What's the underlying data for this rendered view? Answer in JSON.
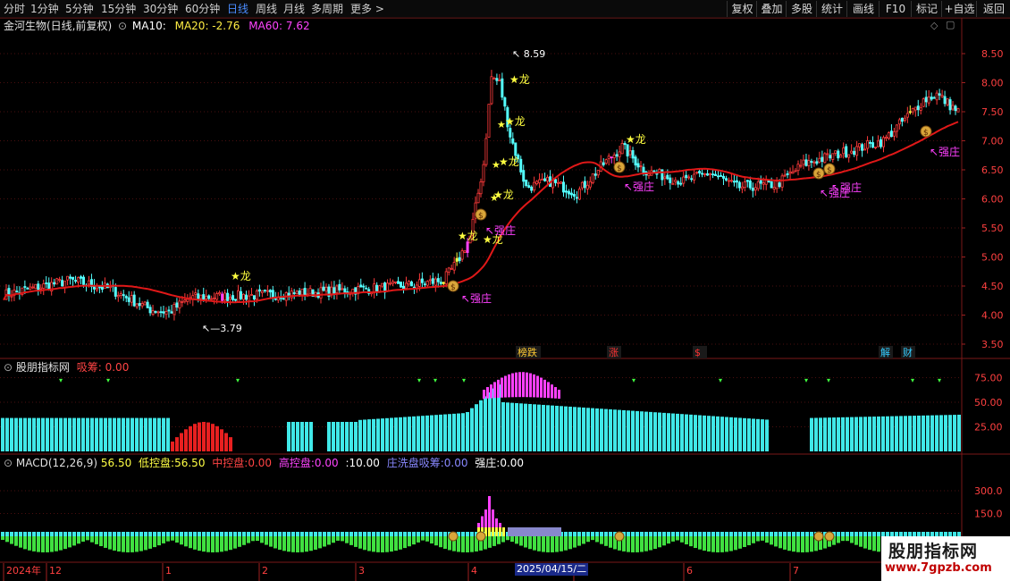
{
  "toolbar": {
    "periods": [
      "分时",
      "1分钟",
      "5分钟",
      "15分钟",
      "30分钟",
      "60分钟",
      "日线",
      "周线",
      "月线",
      "多周期",
      "更多"
    ],
    "active_period": "日线",
    "more_arrow": ">",
    "right_buttons": [
      "复权",
      "叠加",
      "多股",
      "统计",
      "画线",
      "F10",
      "标记",
      "+自选",
      "返回"
    ]
  },
  "main_panel": {
    "title": "金河生物(日线,前复权)",
    "ma_label": "MA10:",
    "ma20": "MA20: -2.76",
    "ma60": "MA60: 7.62",
    "high_label": "8.59",
    "low_label": "3.79",
    "y_ticks": [
      "8.50",
      "8.00",
      "7.50",
      "7.00",
      "6.50",
      "6.00",
      "5.50",
      "5.00",
      "4.50",
      "4.00",
      "3.50"
    ],
    "signal_dragon": "龙",
    "signal_strong": "强庄",
    "bottom_tags": [
      {
        "text": "榜跌",
        "color": "#ffcc33"
      },
      {
        "text": "涨",
        "color": "#ff3333"
      },
      {
        "text": "$",
        "color": "#ff3333"
      },
      {
        "text": "解",
        "color": "#33ccff"
      },
      {
        "text": "财",
        "color": "#33ccff"
      }
    ]
  },
  "chip_panel": {
    "title": "股朋指标网",
    "label": "吸筹:",
    "value": "0.00",
    "y_ticks": [
      "75.00",
      "50.00",
      "25.00"
    ]
  },
  "macd_panel": {
    "title": "MACD(12,26,9)",
    "value": "56.50",
    "items": [
      {
        "label": "低控盘:",
        "value": "56.50",
        "color": "#ffff44"
      },
      {
        "label": "中控盘:",
        "value": "0.00",
        "color": "#ff4444"
      },
      {
        "label": "高控盘:",
        "value": "0.00",
        "color": "#ff44ff"
      },
      {
        "label": ":",
        "value": "10.00",
        "color": "#ffffff"
      },
      {
        "label": "庄洗盘吸筹:",
        "value": "0.00",
        "color": "#8888ff"
      },
      {
        "label": "强庄:",
        "value": "0.00",
        "color": "#ffffff"
      }
    ],
    "y_ticks": [
      "300.0",
      "150.0"
    ]
  },
  "time_axis": {
    "labels": [
      "2024年",
      "12",
      "1",
      "2",
      "3",
      "4",
      "5",
      "6",
      "7"
    ],
    "cursor_date": "2025/04/15/二"
  },
  "watermark": {
    "line1": "股朋指标网",
    "line2": "www.7gpzb.com"
  },
  "colors": {
    "up_candle": "#ff3b3b",
    "down_candle": "#54ffff",
    "ma_line": "#e01818",
    "signal_magenta": "#ff40ff",
    "signal_yellow": "#ffff40",
    "grid": "#4a0f0f"
  }
}
